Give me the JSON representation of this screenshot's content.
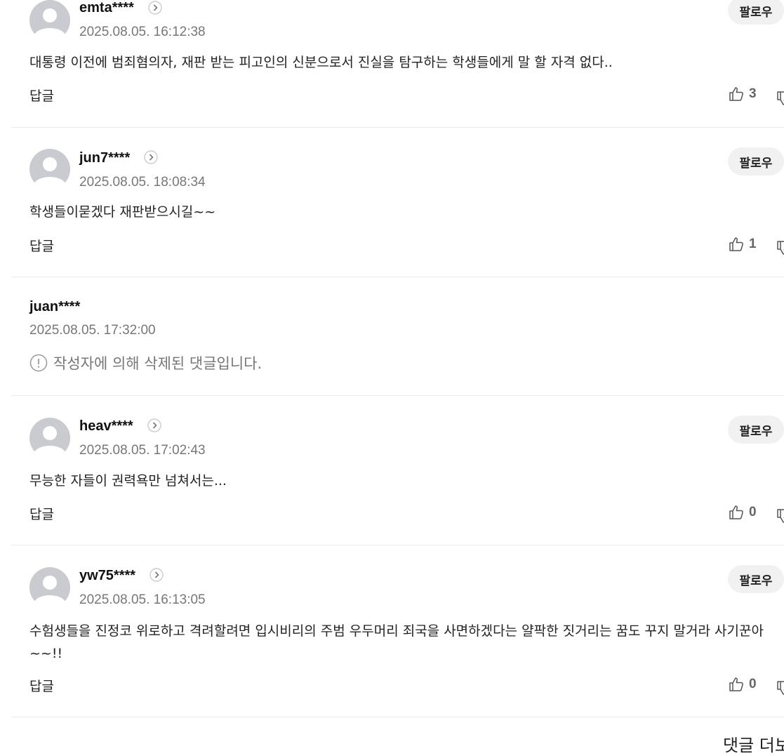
{
  "comments": [
    {
      "user": "emta****",
      "date": "2025.08.05. 16:12:38",
      "text": "대통령 이전에 범죄혐의자, 재판 받는 피고인의 신분으로서 진실을 탐구하는 학생들에게 말 할 자격 없다..",
      "likes": "3",
      "follow_label": "팔로우",
      "reply_label": "답글"
    },
    {
      "user": "jun7****",
      "date": "2025.08.05. 18:08:34",
      "text": "학생들이묻겠다 재판받으시길~~",
      "likes": "1",
      "follow_label": "팔로우",
      "reply_label": "답글"
    },
    {
      "user": "juan****",
      "date": "2025.08.05. 17:32:00",
      "deleted_text": "작성자에 의해 삭제된 댓글입니다."
    },
    {
      "user": "heav****",
      "date": "2025.08.05. 17:02:43",
      "text": "무능한 자들이 권력욕만 넘쳐서는...",
      "likes": "0",
      "follow_label": "팔로우",
      "reply_label": "답글"
    },
    {
      "user": "yw75****",
      "date": "2025.08.05. 16:13:05",
      "text": "수험생들을 진정코 위로하고 격려할려면 입시비리의 주범 우두머리 죄국을 사면하겠다는 얄팍한 짓거리는 꿈도 꾸지 말거라 사기꾼아~~!!",
      "likes": "0",
      "follow_label": "팔로우",
      "reply_label": "답글"
    }
  ],
  "more_comments_label": "댓글 더보기",
  "icons": {
    "avatar": "default-user-avatar",
    "profile": "chevron-right-circle-icon",
    "like": "thumbs-up-icon",
    "dislike": "thumbs-down-icon",
    "deleted": "exclamation-circle-icon"
  }
}
